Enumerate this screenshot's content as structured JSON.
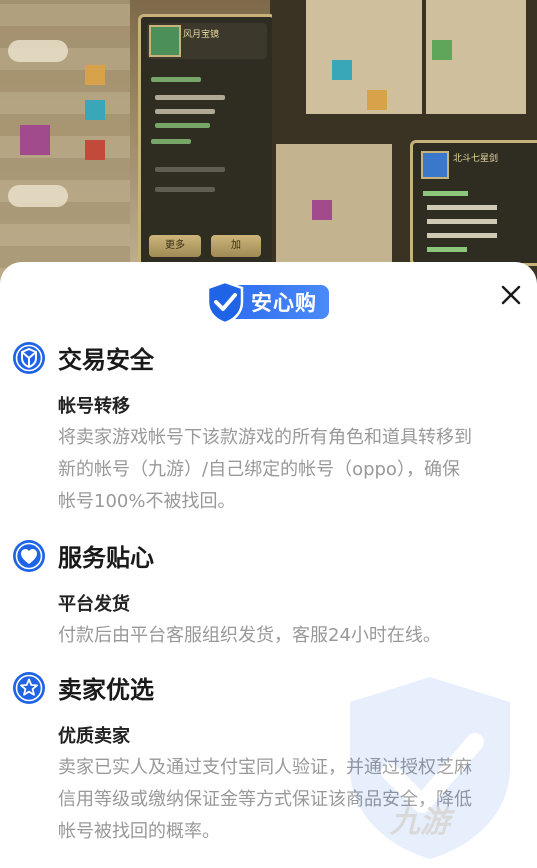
{
  "background": {
    "panel_title_left": "风月宝镜",
    "panel_title_right": "北斗七星剑",
    "more_button": "更多",
    "item_button": "加"
  },
  "sheet": {
    "badge_text": "安心购",
    "close_icon": "close-icon",
    "sections": [
      {
        "icon": "shield-check-icon",
        "title": "交易安全",
        "subtitle": "帐号转移",
        "desc_lines": [
          "将卖家游戏帐号下该款游戏的所有角色和道具转移到",
          "新的帐号（九游）/自己绑定的帐号（oppo），确保",
          "帐号100%不被找回。"
        ]
      },
      {
        "icon": "heart-icon",
        "title": "服务贴心",
        "subtitle": "平台发货",
        "desc_lines": [
          "付款后由平台客服组织发货，客服24小时在线。"
        ]
      },
      {
        "icon": "star-icon",
        "title": "卖家优选",
        "subtitle": "优质卖家",
        "desc_lines": [
          "卖家已实人及通过支付宝同人验证，并通过授权芝麻",
          "信用等级或缴纳保证金等方式保证该商品安全，降低",
          "帐号被找回的概率。"
        ]
      }
    ],
    "watermark_text": "九游"
  },
  "colors": {
    "accent": "#2f6ef0",
    "icon_blue": "#1f63e6",
    "title": "#1a1a1a",
    "desc": "#999999"
  }
}
